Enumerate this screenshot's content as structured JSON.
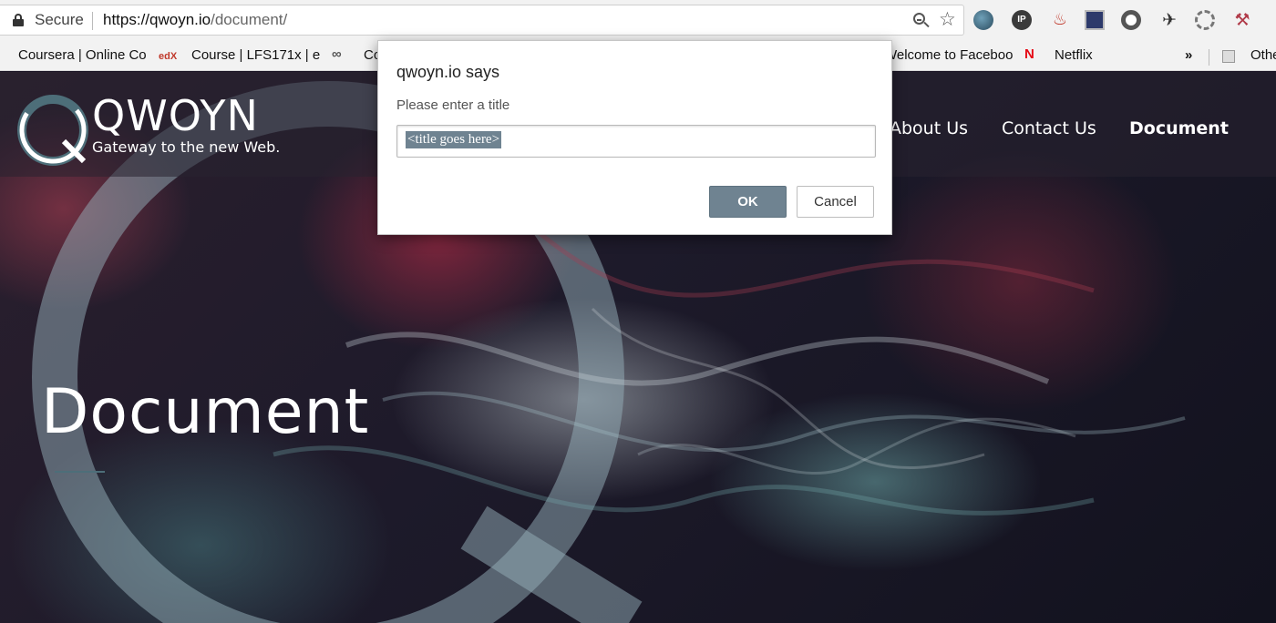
{
  "browser": {
    "secure_label": "Secure",
    "url_host": "https://qwoyn.io",
    "url_path": "/document/"
  },
  "bookmarks": [
    {
      "label": "Coursera | Online Co",
      "icon": "coursera-icon"
    },
    {
      "label": "Course | LFS171x | e",
      "icon": "edx-icon",
      "icon_text": "edX"
    },
    {
      "label": "Co",
      "icon": "infinity-icon"
    },
    {
      "label": "Welcome to Faceboo",
      "icon": ""
    },
    {
      "label": "Netflix",
      "icon": "netflix-icon",
      "icon_text": "N"
    },
    {
      "label": "Othe",
      "icon": "folder-icon"
    }
  ],
  "bookmarks_overflow": "»",
  "site": {
    "logo_name": "QWOYN",
    "logo_tagline": "Gateway to the new Web.",
    "nav": [
      "About Us",
      "Contact Us",
      "Document"
    ],
    "hero_title": "Document"
  },
  "dialog": {
    "title": "qwoyn.io says",
    "message": "Please enter a title",
    "input_value": "<title goes here>",
    "ok_label": "OK",
    "cancel_label": "Cancel"
  },
  "colors": {
    "accent": "#6f8391",
    "logo_ring": "#4d6e79"
  }
}
